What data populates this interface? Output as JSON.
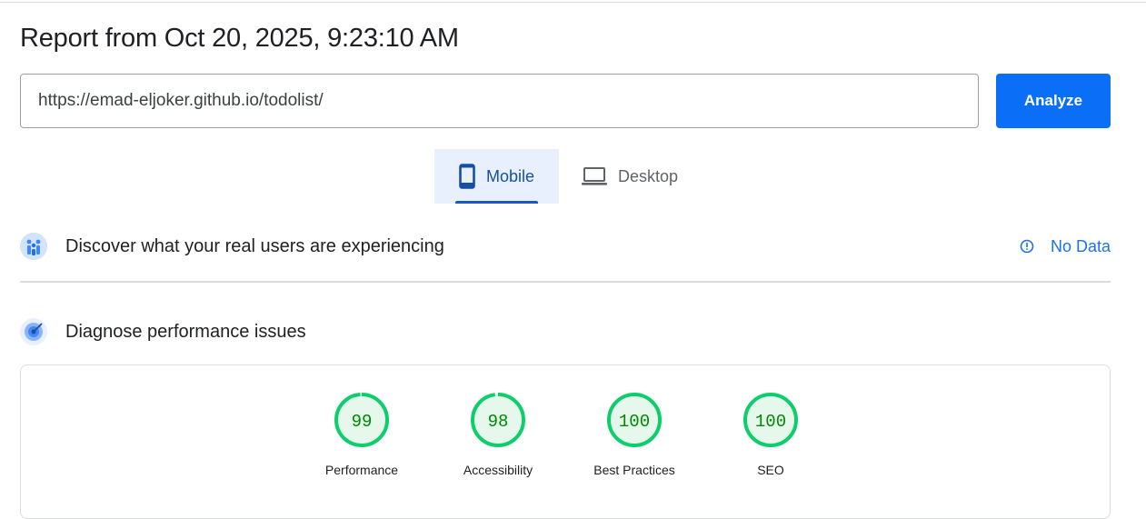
{
  "report": {
    "title": "Report from Oct 20, 2025, 9:23:10 AM"
  },
  "search": {
    "url_value": "https://emad-eljoker.github.io/todolist/",
    "analyze_label": "Analyze"
  },
  "tabs": [
    {
      "label": "Mobile",
      "icon": "smartphone-icon",
      "selected": true
    },
    {
      "label": "Desktop",
      "icon": "laptop-icon",
      "selected": false
    }
  ],
  "field_data": {
    "title": "Discover what your real users are experiencing",
    "status_label": "No Data",
    "icon": "crux-users-icon"
  },
  "lab_data": {
    "title": "Diagnose performance issues",
    "icon": "lighthouse-target-icon"
  },
  "scores": [
    {
      "value": "99",
      "label": "Performance"
    },
    {
      "value": "98",
      "label": "Accessibility"
    },
    {
      "value": "100",
      "label": "Best Practices"
    },
    {
      "value": "100",
      "label": "SEO"
    }
  ],
  "colors": {
    "accent": "#0b6ef6",
    "good": "#0cce6b",
    "good_text": "#008800",
    "good_fill": "#e6f8ec",
    "link": "#1a73e8"
  }
}
